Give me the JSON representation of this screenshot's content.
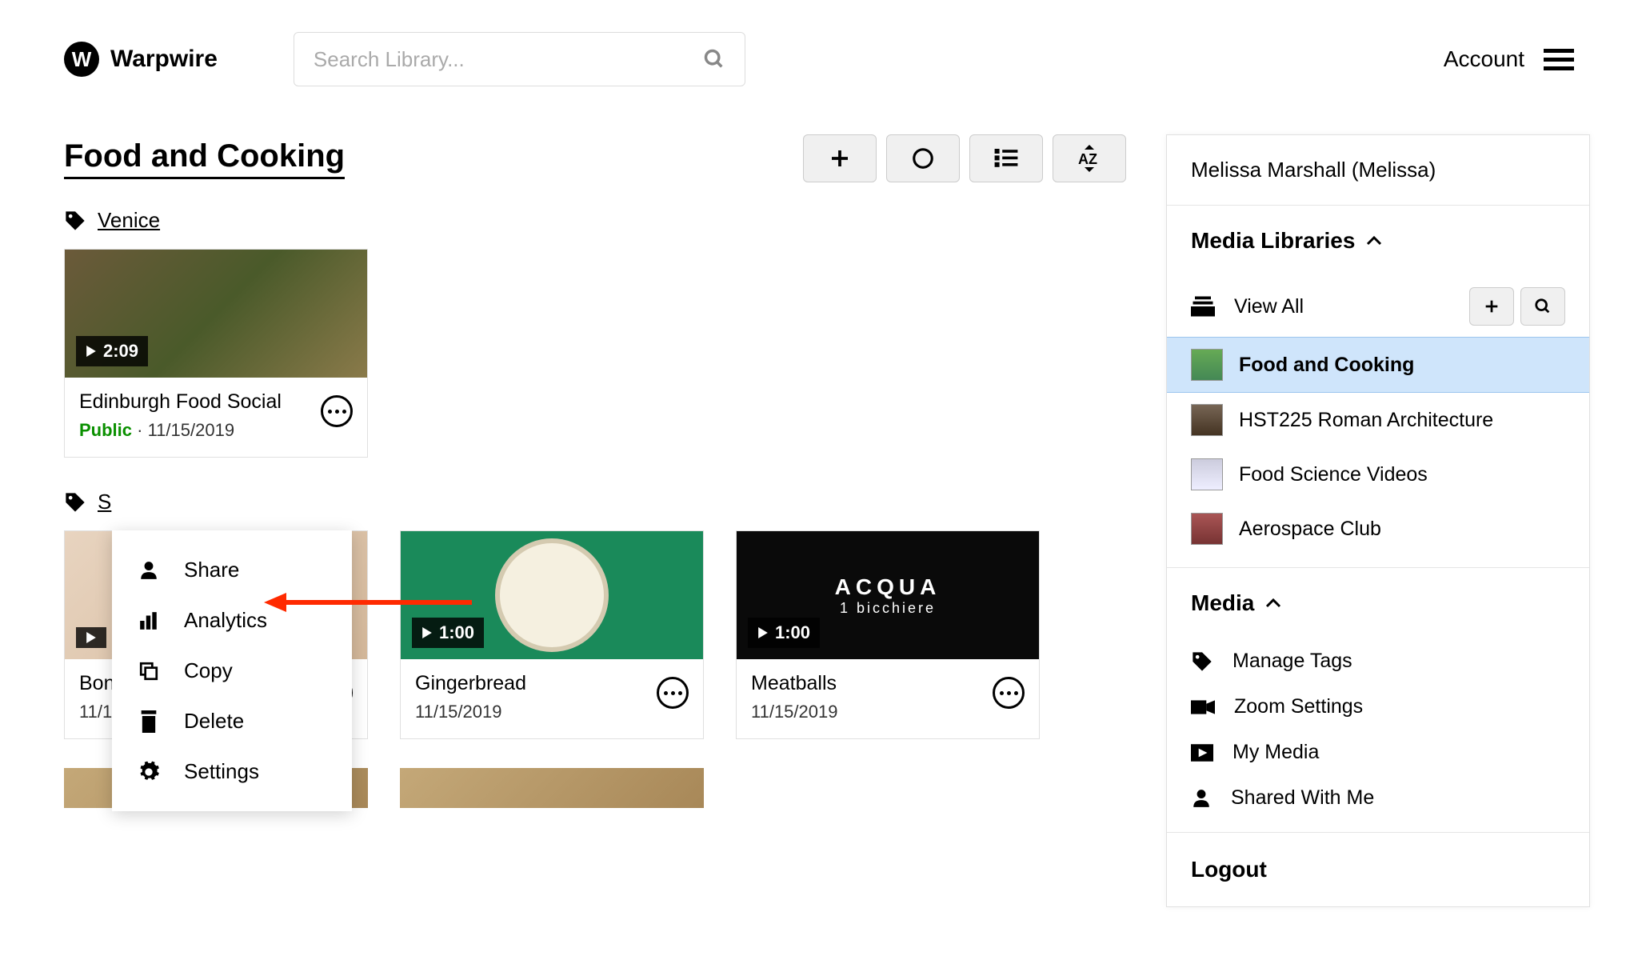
{
  "header": {
    "brand": "Warpwire",
    "search_placeholder": "Search Library...",
    "account_label": "Account"
  },
  "library": {
    "title": "Food and Cooking",
    "tag1": "Venice"
  },
  "cards1": {
    "c0": {
      "duration": "2:09",
      "title": "Edinburgh Food Social",
      "visibility": "Public",
      "date": "11/15/2019"
    }
  },
  "cards2": {
    "c0": {
      "duration": "",
      "title": "Bonne Maman Blueb…",
      "date": "11/15/2019"
    },
    "c1": {
      "duration": "1:00",
      "title": "Gingerbread",
      "date": "11/15/2019"
    },
    "c2": {
      "duration": "1:00",
      "title": "Meatballs",
      "date": "11/15/2019"
    }
  },
  "context_menu": {
    "share": "Share",
    "analytics": "Analytics",
    "copy": "Copy",
    "delete": "Delete",
    "settings": "Settings"
  },
  "sidebar": {
    "user": "Melissa Marshall (Melissa)",
    "media_libraries_h": "Media Libraries",
    "view_all": "View All",
    "libs": {
      "l0": "Food and Cooking",
      "l1": "HST225 Roman Architecture",
      "l2": "Food Science Videos",
      "l3": "Aerospace Club"
    },
    "media_h": "Media",
    "manage_tags": "Manage Tags",
    "zoom_settings": "Zoom Settings",
    "my_media": "My Media",
    "shared_with_me": "Shared With Me",
    "logout": "Logout"
  },
  "thumb_text": {
    "acqua": "ACQUA",
    "bicchiere": "1 bicchiere"
  }
}
